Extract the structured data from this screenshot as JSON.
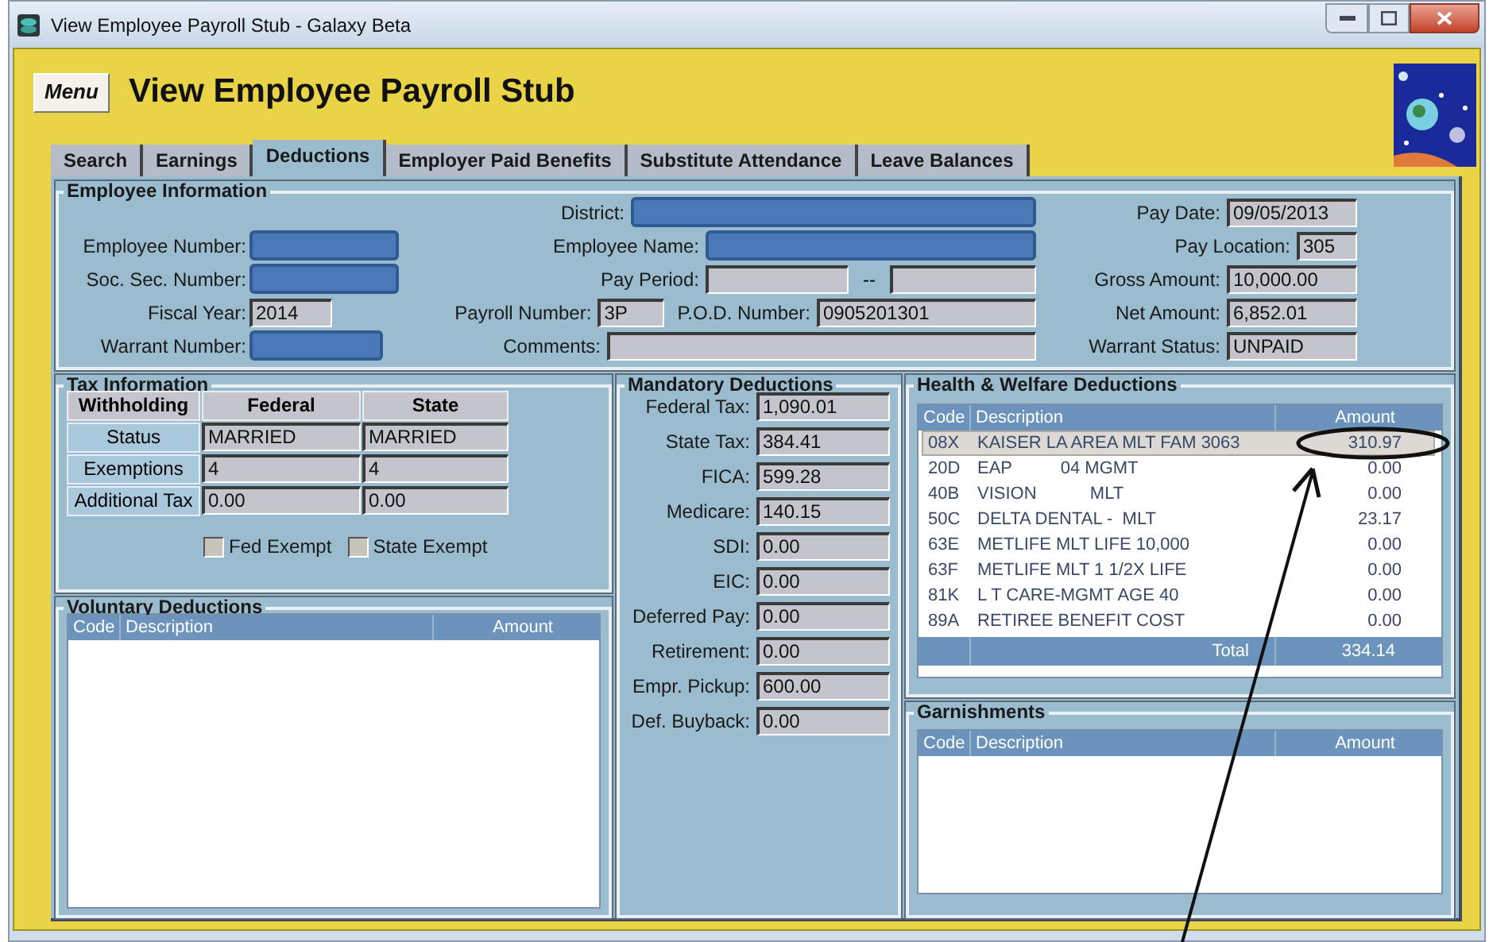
{
  "window": {
    "title": "View Employee Payroll Stub - Galaxy Beta"
  },
  "header": {
    "menu_button": "Menu",
    "title": "View Employee Payroll Stub"
  },
  "tabs": [
    {
      "label": "Search",
      "selected": false
    },
    {
      "label": "Earnings",
      "selected": false
    },
    {
      "label": "Deductions",
      "selected": true
    },
    {
      "label": "Employer Paid Benefits",
      "selected": false
    },
    {
      "label": "Substitute Attendance",
      "selected": false
    },
    {
      "label": "Leave Balances",
      "selected": false
    }
  ],
  "employee_information": {
    "title": "Employee Information",
    "left": [
      {
        "label": "Employee Number:",
        "redacted": true
      },
      {
        "label": "Soc. Sec. Number:",
        "redacted": true
      },
      {
        "label": "Fiscal Year:",
        "value": "2014",
        "redacted": false
      },
      {
        "label": "Warrant Number:",
        "redacted": true
      }
    ],
    "middle": [
      {
        "kind": "single",
        "label": "District:",
        "redacted": true
      },
      {
        "kind": "single",
        "label": "Employee Name:",
        "redacted": true
      },
      {
        "kind": "range",
        "label": "Pay Period:",
        "separator": "--",
        "redacted": false
      },
      {
        "kind": "pair",
        "label": "Payroll Number:",
        "value": "3P",
        "label_2": "P.O.D. Number:",
        "value_2": "0905201301",
        "redacted": false
      },
      {
        "kind": "single",
        "label": "Comments:",
        "redacted": false
      }
    ],
    "right": [
      {
        "label": "Pay Date:",
        "value": "09/05/2013"
      },
      {
        "label": "Pay Location:",
        "value": "305"
      },
      {
        "label": "Gross Amount:",
        "value": "10,000.00"
      },
      {
        "label": "Net Amount:",
        "value": "6,852.01"
      },
      {
        "label": "Warrant Status:",
        "value": "UNPAID"
      }
    ]
  },
  "tax_information": {
    "title": "Tax Information",
    "columns": [
      "Withholding",
      "Federal",
      "State"
    ],
    "rows": [
      {
        "label": "Status",
        "federal": "MARRIED",
        "state": "MARRIED"
      },
      {
        "label": "Exemptions",
        "federal": "4",
        "state": "4"
      },
      {
        "label": "Additional Tax",
        "federal": "0.00",
        "state": "0.00"
      }
    ],
    "checkboxes": [
      {
        "label": "Fed Exempt",
        "checked": false
      },
      {
        "label": "State Exempt",
        "checked": false
      }
    ]
  },
  "voluntary_deductions": {
    "title": "Voluntary Deductions",
    "columns": [
      "Code",
      "Description",
      "Amount"
    ]
  },
  "mandatory_deductions": {
    "title": "Mandatory Deductions",
    "fields": [
      {
        "label": "Federal Tax:",
        "value": "1,090.01"
      },
      {
        "label": "State Tax:",
        "value": "384.41"
      },
      {
        "label": "FICA:",
        "value": "599.28"
      },
      {
        "label": "Medicare:",
        "value": "140.15"
      },
      {
        "label": "SDI:",
        "value": "0.00"
      },
      {
        "label": "EIC:",
        "value": "0.00"
      },
      {
        "label": "Deferred Pay:",
        "value": "0.00"
      },
      {
        "label": "Retirement:",
        "value": "0.00"
      },
      {
        "label": "Empr. Pickup:",
        "value": "600.00"
      },
      {
        "label": "Def. Buyback:",
        "value": "0.00"
      }
    ]
  },
  "health_welfare_deductions": {
    "title": "Health & Welfare Deductions",
    "columns": [
      "Code",
      "Description",
      "Amount"
    ],
    "rows": [
      {
        "code": "08X",
        "description": "KAISER LA AREA MLT FAM 3063",
        "amount": "310.97",
        "selected": true
      },
      {
        "code": "20D",
        "description": "EAP          04 MGMT",
        "amount": "0.00",
        "selected": false
      },
      {
        "code": "40B",
        "description": "VISION           MLT",
        "amount": "0.00",
        "selected": false
      },
      {
        "code": "50C",
        "description": "DELTA DENTAL -  MLT",
        "amount": "23.17",
        "selected": false
      },
      {
        "code": "63E",
        "description": "METLIFE MLT LIFE 10,000",
        "amount": "0.00",
        "selected": false
      },
      {
        "code": "63F",
        "description": "METLIFE MLT 1 1/2X LIFE",
        "amount": "0.00",
        "selected": false
      },
      {
        "code": "81K",
        "description": "L T CARE-MGMT AGE 40",
        "amount": "0.00",
        "selected": false
      },
      {
        "code": "89A",
        "description": "RETIREE BENEFIT COST",
        "amount": "0.00",
        "selected": false
      }
    ],
    "total_label": "Total",
    "total": "334.14"
  },
  "garnishments": {
    "title": "Garnishments",
    "columns": [
      "Code",
      "Description",
      "Amount"
    ]
  }
}
